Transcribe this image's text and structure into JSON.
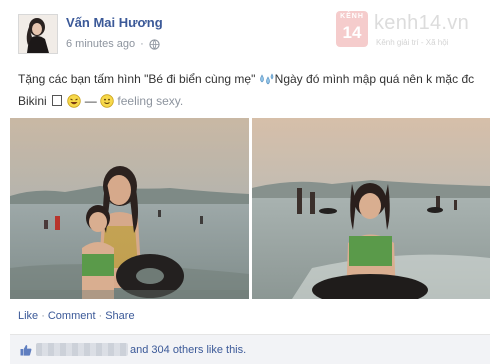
{
  "post": {
    "author": "Vấn Mai Hương",
    "time": "6 minutes ago",
    "status_part1": "Tặng các bạn tấm hình \"Bé đi biển cùng mẹ\"",
    "status_part2": "Ngày đó mình mập quá nên k mặc đc Bikini",
    "feeling_prefix": " — ",
    "feeling": "feeling sexy."
  },
  "watermark": {
    "badge_top": "KÊNH",
    "badge_num": "14",
    "site": "kenh14.vn",
    "tagline": "Kênh giải trí - Xã hội"
  },
  "actions": {
    "like": "Like",
    "comment": "Comment",
    "share": "Share",
    "separator": "·"
  },
  "likes": {
    "text": "and 304 others like this."
  },
  "icons": {
    "privacy": "globe-icon",
    "sweat": "sweat-drops-icon",
    "laugh": "laughing-emoji-icon",
    "feeling": "smiley-icon",
    "like_thumb": "thumbs-up-icon"
  },
  "colors": {
    "link": "#3b5998",
    "muted": "#8d949e",
    "likes_bg": "#f2f3f6",
    "watermark_badge": "#f4c7c7"
  }
}
